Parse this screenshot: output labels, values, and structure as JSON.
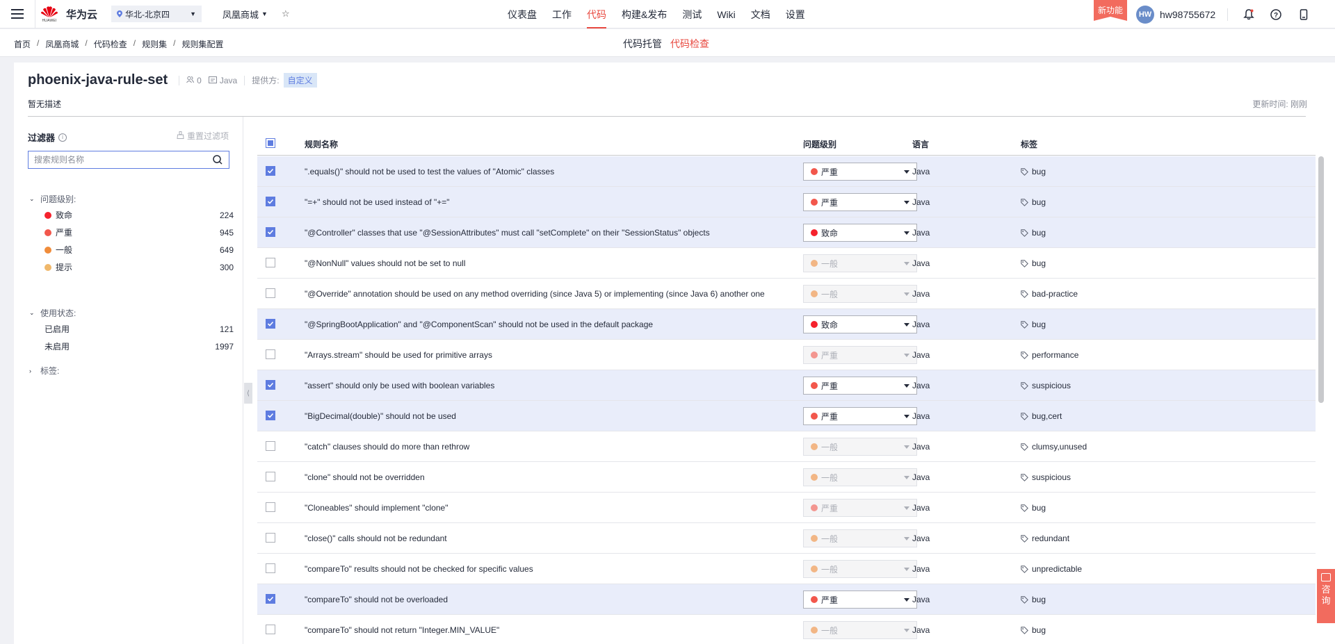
{
  "topnav": {
    "brand": "华为云",
    "logo_sub": "HUAWEI",
    "region": "华北-北京四",
    "project": "凤凰商城",
    "menu": [
      {
        "label": "仪表盘",
        "active": false
      },
      {
        "label": "工作",
        "active": false
      },
      {
        "label": "代码",
        "active": true
      },
      {
        "label": "构建&发布",
        "active": false
      },
      {
        "label": "测试",
        "active": false
      },
      {
        "label": "Wiki",
        "active": false
      },
      {
        "label": "文档",
        "active": false
      },
      {
        "label": "设置",
        "active": false
      }
    ],
    "new_feature": "新功能",
    "avatar": "HW",
    "username": "hw98755672",
    "icons": [
      "bell-icon",
      "help-icon",
      "mobile-icon"
    ]
  },
  "breadcrumb": [
    "首页",
    "凤凰商城",
    "代码检查",
    "规则集",
    "规则集配置"
  ],
  "subtabs": [
    {
      "label": "代码托管",
      "active": false
    },
    {
      "label": "代码检查",
      "active": true
    }
  ],
  "ruleset": {
    "title": "phoenix-java-rule-set",
    "users": "0",
    "language": "Java",
    "provider_label": "提供方:",
    "provider_value": "自定义",
    "description": "暂无描述",
    "updated": "更新时间: 刚刚"
  },
  "filter": {
    "title": "过滤器",
    "reset": "重置过滤项",
    "search_placeholder": "搜索规则名称",
    "severity_label": "问题级别:",
    "severity": [
      {
        "label": "致命",
        "count": "224",
        "color": "#f5222d"
      },
      {
        "label": "严重",
        "count": "945",
        "color": "#f2574c"
      },
      {
        "label": "一般",
        "count": "649",
        "color": "#f08c3a"
      },
      {
        "label": "提示",
        "count": "300",
        "color": "#f0b86b"
      }
    ],
    "status_label": "使用状态:",
    "status": [
      {
        "label": "已启用",
        "count": "121"
      },
      {
        "label": "未启用",
        "count": "1997"
      }
    ],
    "tags_label": "标签:"
  },
  "table": {
    "headers": {
      "name": "规则名称",
      "severity": "问题级别",
      "language": "语言",
      "tags": "标签"
    },
    "rows": [
      {
        "checked": true,
        "name": "\".equals()\" should not be used to test the values of \"Atomic\" classes",
        "severity": "严重",
        "sev_color": "#f2574c",
        "lang": "Java",
        "tags": "bug"
      },
      {
        "checked": true,
        "name": "\"=+\" should not be used instead of \"+=\"",
        "severity": "严重",
        "sev_color": "#f2574c",
        "lang": "Java",
        "tags": "bug"
      },
      {
        "checked": true,
        "name": "\"@Controller\" classes that use \"@SessionAttributes\" must call \"setComplete\" on their \"SessionStatus\" objects",
        "severity": "致命",
        "sev_color": "#f5222d",
        "lang": "Java",
        "tags": "bug"
      },
      {
        "checked": false,
        "name": "\"@NonNull\" values should not be set to null",
        "severity": "一般",
        "sev_color": "#f08c3a",
        "lang": "Java",
        "tags": "bug"
      },
      {
        "checked": false,
        "name": "\"@Override\" annotation should be used on any method overriding (since Java 5) or implementing (since Java 6) another one",
        "severity": "一般",
        "sev_color": "#f08c3a",
        "lang": "Java",
        "tags": "bad-practice"
      },
      {
        "checked": true,
        "name": "\"@SpringBootApplication\" and \"@ComponentScan\" should not be used in the default package",
        "severity": "致命",
        "sev_color": "#f5222d",
        "lang": "Java",
        "tags": "bug"
      },
      {
        "checked": false,
        "name": "\"Arrays.stream\" should be used for primitive arrays",
        "severity": "严重",
        "sev_color": "#f2574c",
        "lang": "Java",
        "tags": "performance"
      },
      {
        "checked": true,
        "name": "\"assert\" should only be used with boolean variables",
        "severity": "严重",
        "sev_color": "#f2574c",
        "lang": "Java",
        "tags": "suspicious"
      },
      {
        "checked": true,
        "name": "\"BigDecimal(double)\" should not be used",
        "severity": "严重",
        "sev_color": "#f2574c",
        "lang": "Java",
        "tags": "bug,cert"
      },
      {
        "checked": false,
        "name": "\"catch\" clauses should do more than rethrow",
        "severity": "一般",
        "sev_color": "#f08c3a",
        "lang": "Java",
        "tags": "clumsy,unused"
      },
      {
        "checked": false,
        "name": "\"clone\" should not be overridden",
        "severity": "一般",
        "sev_color": "#f08c3a",
        "lang": "Java",
        "tags": "suspicious"
      },
      {
        "checked": false,
        "name": "\"Cloneables\" should implement \"clone\"",
        "severity": "严重",
        "sev_color": "#f2574c",
        "lang": "Java",
        "tags": "bug"
      },
      {
        "checked": false,
        "name": "\"close()\" calls should not be redundant",
        "severity": "一般",
        "sev_color": "#f08c3a",
        "lang": "Java",
        "tags": "redundant"
      },
      {
        "checked": false,
        "name": "\"compareTo\" results should not be checked for specific values",
        "severity": "一般",
        "sev_color": "#f08c3a",
        "lang": "Java",
        "tags": "unpredictable"
      },
      {
        "checked": true,
        "name": "\"compareTo\" should not be overloaded",
        "severity": "严重",
        "sev_color": "#f2574c",
        "lang": "Java",
        "tags": "bug"
      },
      {
        "checked": false,
        "name": "\"compareTo\" should not return \"Integer.MIN_VALUE\"",
        "severity": "一般",
        "sev_color": "#f08c3a",
        "lang": "Java",
        "tags": "bug"
      }
    ]
  },
  "consult": [
    "咨",
    "询"
  ]
}
